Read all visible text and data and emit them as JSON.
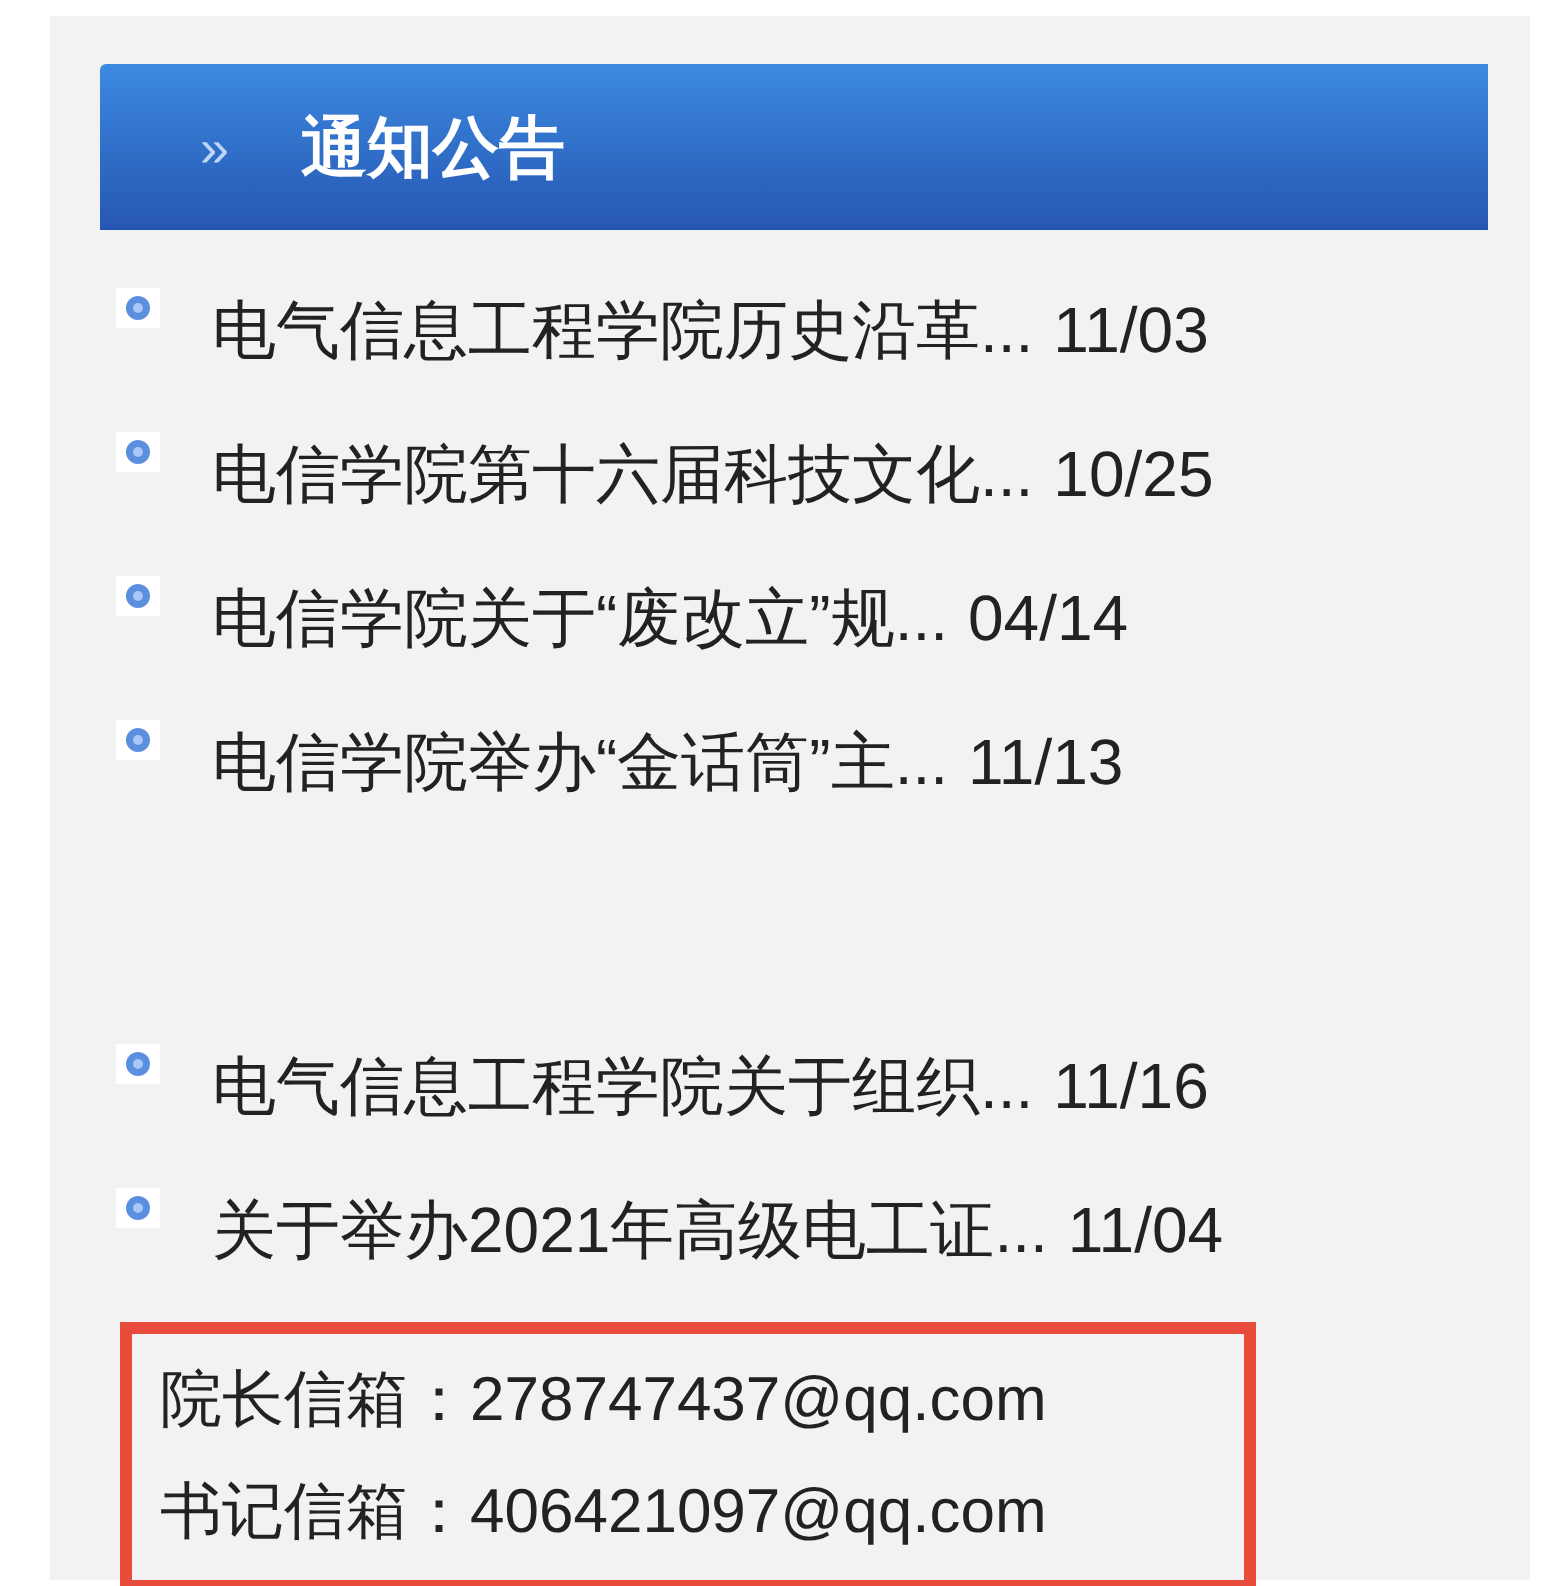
{
  "header": {
    "icon_text": "»",
    "title": "通知公告"
  },
  "notice_groups": [
    {
      "items": [
        {
          "title": "电气信息工程学院历史沿革...",
          "date": "11/03"
        },
        {
          "title": "电信学院第十六届科技文化...",
          "date": "10/25"
        },
        {
          "title": "电信学院关于“废改立”规...",
          "date": "04/14"
        },
        {
          "title": "电信学院举办“金话筒”主...",
          "date": "11/13"
        }
      ]
    },
    {
      "items": [
        {
          "title": "电气信息工程学院关于组织...",
          "date": "11/16"
        },
        {
          "title": "关于举办2021年高级电工证...",
          "date": "11/04"
        }
      ]
    }
  ],
  "contacts": [
    {
      "label": "院长信箱：",
      "email": "278747437@qq.com"
    },
    {
      "label": "书记信箱：",
      "email": "406421097@qq.com"
    }
  ]
}
